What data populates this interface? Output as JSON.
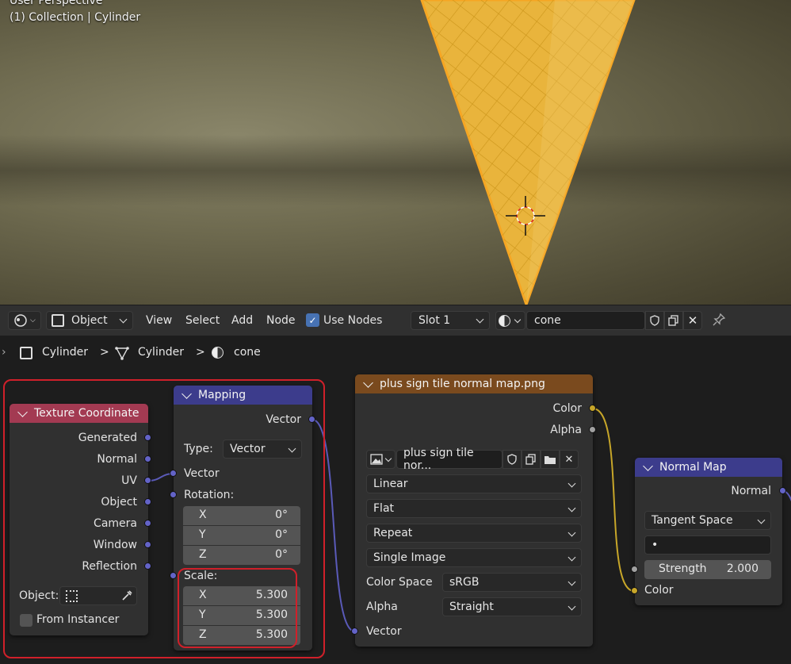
{
  "viewport": {
    "title": "User Perspective",
    "collection_text": "(1) Collection | Cylinder"
  },
  "header": {
    "editor_type_icon": "shader-editor-icon",
    "mode_label": "Object",
    "menus": [
      "View",
      "Select",
      "Add",
      "Node"
    ],
    "use_nodes_label": "Use Nodes",
    "use_nodes_checked": true,
    "slot_label": "Slot 1",
    "material_name": "cone"
  },
  "breadcrumb": {
    "items": [
      "Cylinder",
      "Cylinder",
      "cone"
    ],
    "separator": ">"
  },
  "nodes": {
    "texture_coordinate": {
      "title": "Texture Coordinate",
      "header_color": "#a33a52",
      "outputs": [
        "Generated",
        "Normal",
        "UV",
        "Object",
        "Camera",
        "Window",
        "Reflection"
      ],
      "object_label": "Object:",
      "from_instancer_label": "From Instancer"
    },
    "mapping": {
      "title": "Mapping",
      "header_color": "#3c3c8c",
      "output": "Vector",
      "type_label": "Type:",
      "type_value": "Vector",
      "vector_input": "Vector",
      "rotation_label": "Rotation:",
      "rotation": [
        {
          "axis": "X",
          "value": "0°"
        },
        {
          "axis": "Y",
          "value": "0°"
        },
        {
          "axis": "Z",
          "value": "0°"
        }
      ],
      "scale_label": "Scale:",
      "scale": [
        {
          "axis": "X",
          "value": "5.300"
        },
        {
          "axis": "Y",
          "value": "5.300"
        },
        {
          "axis": "Z",
          "value": "5.300"
        }
      ]
    },
    "image_texture": {
      "title": "plus sign tile normal map.png",
      "header_color": "#7a4a1e",
      "outputs": [
        "Color",
        "Alpha"
      ],
      "image_name": "plus sign tile nor...",
      "interpolation": "Linear",
      "projection": "Flat",
      "extension": "Repeat",
      "source": "Single Image",
      "color_space_label": "Color Space",
      "color_space_value": "sRGB",
      "alpha_label": "Alpha",
      "alpha_value": "Straight",
      "vector_input": "Vector"
    },
    "normal_map": {
      "title": "Normal Map",
      "header_color": "#3c3c8c",
      "output": "Normal",
      "space": "Tangent Space",
      "uv_map_value": "•",
      "strength_label": "Strength",
      "strength_value": "2.000",
      "color_input": "Color"
    }
  },
  "colors": {
    "highlight": "#d0202a",
    "socket_vector": "#6363c7",
    "socket_color": "#c7a629",
    "wire_vector": "#5a5ab8",
    "wire_color": "#c7a629",
    "selected_cone": "#e8b23a"
  }
}
